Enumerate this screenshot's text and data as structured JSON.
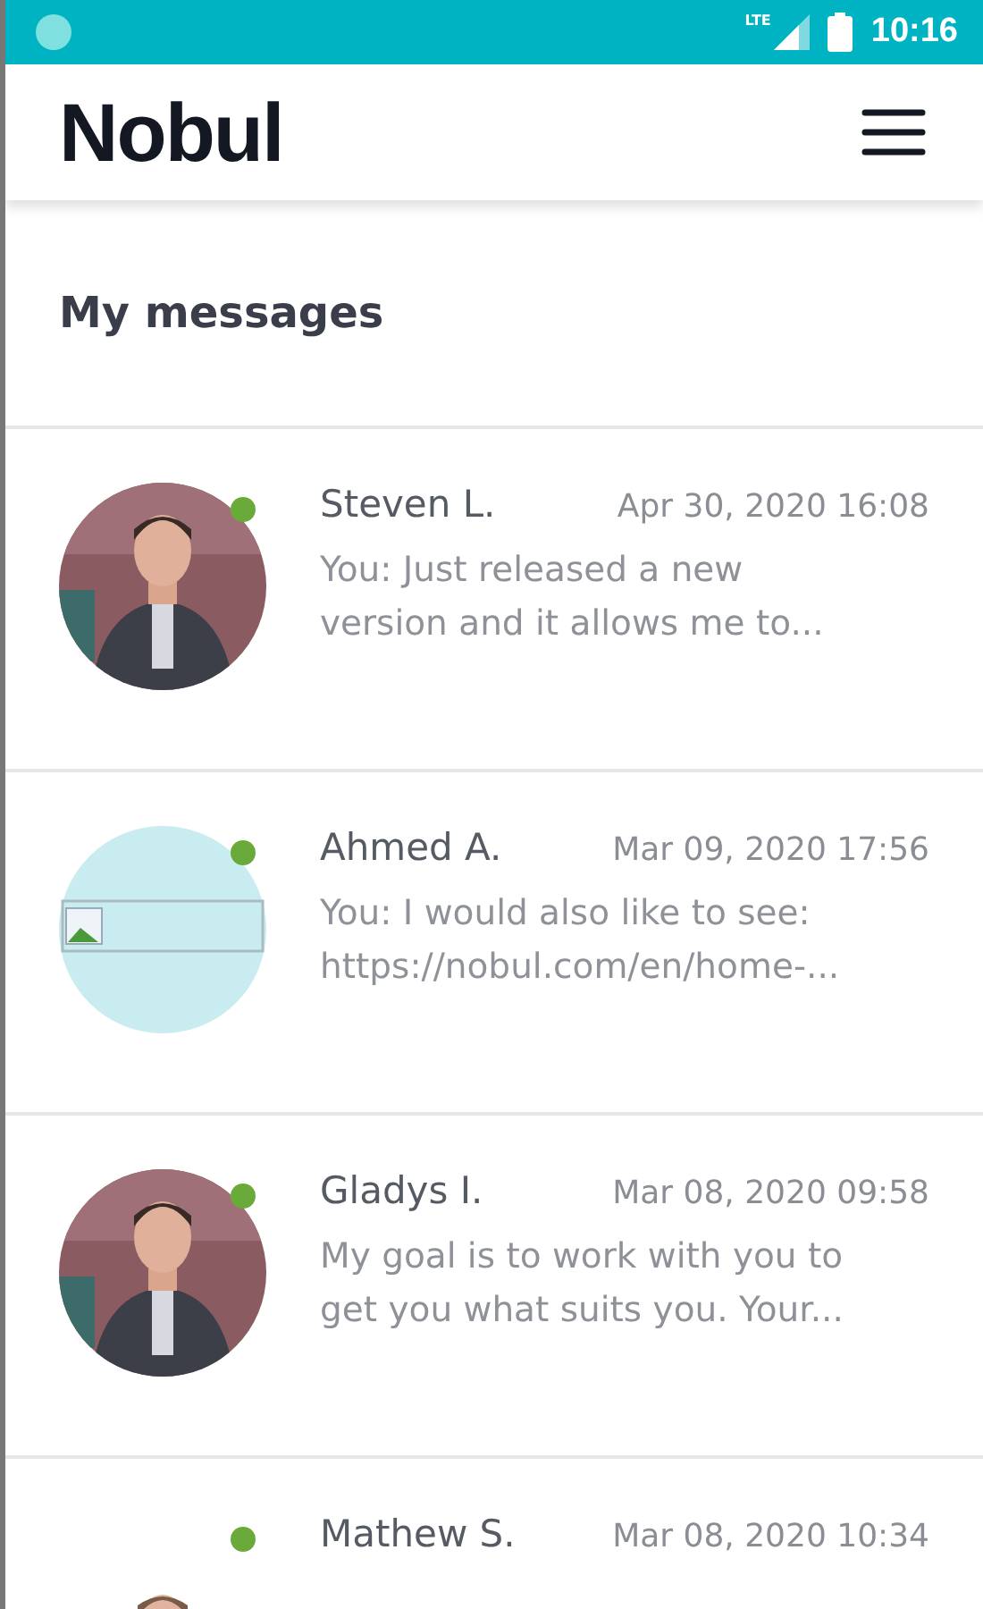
{
  "status_bar": {
    "time": "10:16",
    "network": "LTE"
  },
  "header": {
    "logo": "Nobul"
  },
  "page_title": "My messages",
  "messages": [
    {
      "name": "Steven L.",
      "date": "Apr 30, 2020 16:08",
      "preview": "You: Just released a new version and it allows me to...",
      "online": true
    },
    {
      "name": "Ahmed A.",
      "date": "Mar 09, 2020 17:56",
      "preview": "You: I would also like to see: https://nobul.com/en/home-...",
      "online": true,
      "avatar": {
        "kind": "broken_image"
      }
    },
    {
      "name": "Gladys I.",
      "date": "Mar 08, 2020 09:58",
      "preview": "My goal is to work with you to get you what suits you. Your...",
      "online": true
    },
    {
      "name": "Mathew S.",
      "date": "Mar 08, 2020 10:34",
      "online": true,
      "avatar": {
        "kind": "small_photo"
      }
    }
  ]
}
